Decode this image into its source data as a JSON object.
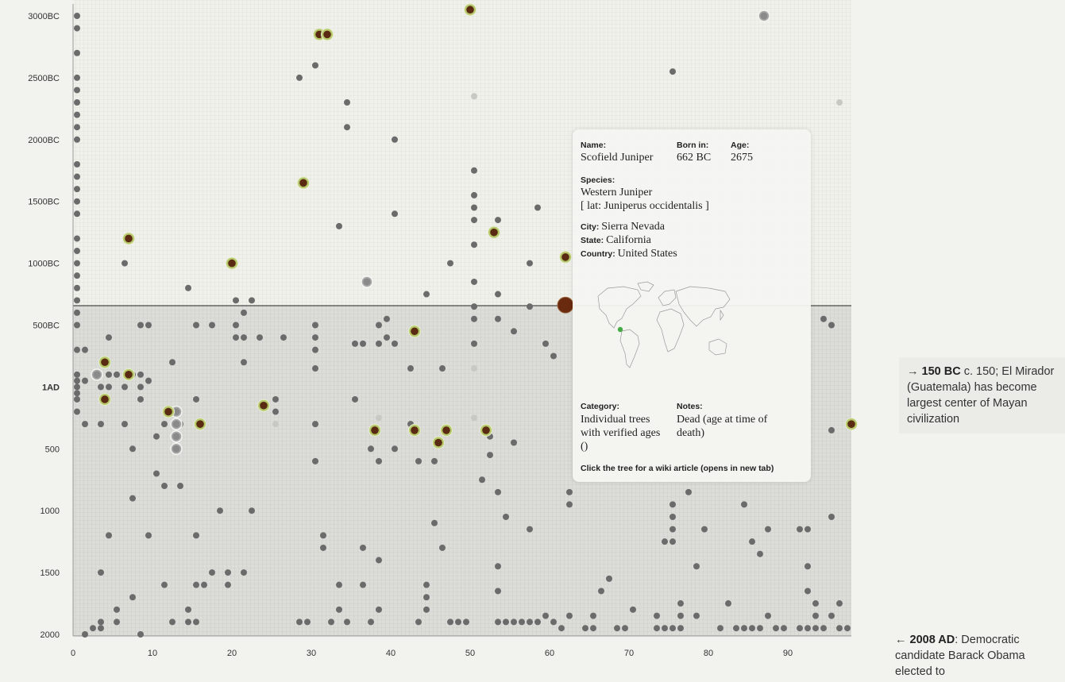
{
  "chart_data": {
    "type": "scatter",
    "title": "",
    "xlabel": "",
    "ylabel": "",
    "xlim": [
      0,
      98
    ],
    "ylim_year": [
      -3050,
      2008
    ],
    "x_ticks": [
      "0",
      "10",
      "20",
      "30",
      "40",
      "50",
      "60",
      "70",
      "80",
      "90"
    ],
    "y_ticks": [
      {
        "label": "3000BC",
        "year": -3000
      },
      {
        "label": "2500BC",
        "year": -2500
      },
      {
        "label": "2000BC",
        "year": -2000
      },
      {
        "label": "1500BC",
        "year": -1500
      },
      {
        "label": "1000BC",
        "year": -1000
      },
      {
        "label": "500BC",
        "year": -500
      },
      {
        "label": "1AD",
        "year": 1
      },
      {
        "label": "500",
        "year": 500
      },
      {
        "label": "1000",
        "year": 1000
      },
      {
        "label": "1500",
        "year": 1500
      },
      {
        "label": "2000",
        "year": 2000
      }
    ],
    "current_year": -150,
    "grid": true,
    "highlighted": {
      "x": 62,
      "year": -662
    },
    "series": [
      {
        "name": "",
        "color": "#6b6b6b",
        "points": [
          [
            0.5,
            -3000
          ],
          [
            0.5,
            -2900
          ],
          [
            0.5,
            -2700
          ],
          [
            0.5,
            -2500
          ],
          [
            0.5,
            -2400
          ],
          [
            0.5,
            -2300
          ],
          [
            0.5,
            -2200
          ],
          [
            0.5,
            -2100
          ],
          [
            0.5,
            -2000
          ],
          [
            0.5,
            -1800
          ],
          [
            0.5,
            -1700
          ],
          [
            0.5,
            -1600
          ],
          [
            0.5,
            -1500
          ],
          [
            0.5,
            -1400
          ],
          [
            0.5,
            -1200
          ],
          [
            0.5,
            -1100
          ],
          [
            0.5,
            -1000
          ],
          [
            0.5,
            -900
          ],
          [
            0.5,
            -800
          ],
          [
            0.5,
            -700
          ],
          [
            0.5,
            -600
          ],
          [
            0.5,
            -500
          ],
          [
            0.5,
            -300
          ],
          [
            0.5,
            -100
          ],
          [
            0.5,
            -50
          ],
          [
            0.5,
            0
          ],
          [
            0.5,
            50
          ],
          [
            0.5,
            100
          ],
          [
            0.5,
            200
          ],
          [
            1.5,
            -300
          ],
          [
            1.5,
            -50
          ],
          [
            1.5,
            300
          ],
          [
            1.5,
            2000
          ],
          [
            2.5,
            1950
          ],
          [
            3.5,
            0
          ],
          [
            3.5,
            300
          ],
          [
            3.5,
            1500
          ],
          [
            3.5,
            1900
          ],
          [
            3.5,
            1950
          ],
          [
            4.5,
            -400
          ],
          [
            4.5,
            0
          ],
          [
            4.5,
            -100
          ],
          [
            4.5,
            1200
          ],
          [
            5.5,
            -100
          ],
          [
            5.5,
            1800
          ],
          [
            5.5,
            1900
          ],
          [
            6.5,
            -1000
          ],
          [
            6.5,
            300
          ],
          [
            6.5,
            0
          ],
          [
            7.5,
            -100
          ],
          [
            7.5,
            500
          ],
          [
            7.5,
            900
          ],
          [
            7.5,
            1700
          ],
          [
            8.5,
            -500
          ],
          [
            8.5,
            0
          ],
          [
            8.5,
            -100
          ],
          [
            8.5,
            100
          ],
          [
            8.5,
            2000
          ],
          [
            9.5,
            -500
          ],
          [
            9.5,
            -50
          ],
          [
            9.5,
            1200
          ],
          [
            10.5,
            400
          ],
          [
            10.5,
            700
          ],
          [
            11.5,
            300
          ],
          [
            11.5,
            800
          ],
          [
            11.5,
            1600
          ],
          [
            12.5,
            -200
          ],
          [
            12.5,
            1900
          ],
          [
            13.5,
            300
          ],
          [
            13.5,
            800
          ],
          [
            14.5,
            -800
          ],
          [
            14.5,
            1800
          ],
          [
            14.5,
            1900
          ],
          [
            15.5,
            -500
          ],
          [
            15.5,
            100
          ],
          [
            15.5,
            1200
          ],
          [
            15.5,
            1600
          ],
          [
            15.5,
            1900
          ],
          [
            16.5,
            1600
          ],
          [
            17.5,
            -500
          ],
          [
            17.5,
            1500
          ],
          [
            18.5,
            1000
          ],
          [
            19.5,
            1500
          ],
          [
            19.5,
            1600
          ],
          [
            20.5,
            -700
          ],
          [
            20.5,
            -500
          ],
          [
            20.5,
            -400
          ],
          [
            21.5,
            -600
          ],
          [
            21.5,
            -400
          ],
          [
            21.5,
            -200
          ],
          [
            21.5,
            1500
          ],
          [
            22.5,
            -700
          ],
          [
            22.5,
            1000
          ],
          [
            23.5,
            -400
          ],
          [
            25.5,
            200
          ],
          [
            25.5,
            100
          ],
          [
            26.5,
            -400
          ],
          [
            28.5,
            -2500
          ],
          [
            28.5,
            1900
          ],
          [
            29.5,
            1900
          ],
          [
            30.5,
            -2600
          ],
          [
            30.5,
            -500
          ],
          [
            30.5,
            -400
          ],
          [
            30.5,
            -300
          ],
          [
            30.5,
            -150
          ],
          [
            30.5,
            300
          ],
          [
            30.5,
            600
          ],
          [
            31.5,
            1200
          ],
          [
            31.5,
            1300
          ],
          [
            32.5,
            1900
          ],
          [
            33.5,
            -1300
          ],
          [
            33.5,
            1600
          ],
          [
            33.5,
            1800
          ],
          [
            34.5,
            -2300
          ],
          [
            34.5,
            -2100
          ],
          [
            34.5,
            1900
          ],
          [
            35.5,
            -350
          ],
          [
            35.5,
            100
          ],
          [
            36.5,
            -350
          ],
          [
            36.5,
            1300
          ],
          [
            36.5,
            1600
          ],
          [
            37.5,
            500
          ],
          [
            37.5,
            1900
          ],
          [
            38.5,
            -500
          ],
          [
            38.5,
            -350
          ],
          [
            38.5,
            600
          ],
          [
            38.5,
            1400
          ],
          [
            38.5,
            1800
          ],
          [
            39.5,
            -550
          ],
          [
            39.5,
            -400
          ],
          [
            40.5,
            -2000
          ],
          [
            40.5,
            -1400
          ],
          [
            40.5,
            -350
          ],
          [
            40.5,
            500
          ],
          [
            42.5,
            -150
          ],
          [
            42.5,
            300
          ],
          [
            43.5,
            600
          ],
          [
            43.5,
            1900
          ],
          [
            44.5,
            -750
          ],
          [
            44.5,
            1600
          ],
          [
            44.5,
            1700
          ],
          [
            44.5,
            1800
          ],
          [
            45.5,
            600
          ],
          [
            45.5,
            1100
          ],
          [
            46.5,
            -150
          ],
          [
            46.5,
            1300
          ],
          [
            47.5,
            -1000
          ],
          [
            47.5,
            1900
          ],
          [
            48.5,
            1900
          ],
          [
            49.5,
            1900
          ],
          [
            50.5,
            -1750
          ],
          [
            50.5,
            -1550
          ],
          [
            50.5,
            -1450
          ],
          [
            50.5,
            -1350
          ],
          [
            50.5,
            -1150
          ],
          [
            50.5,
            -850
          ],
          [
            50.5,
            -650
          ],
          [
            50.5,
            -550
          ],
          [
            50.5,
            -350
          ],
          [
            51.5,
            750
          ],
          [
            52.5,
            400
          ],
          [
            52.5,
            550
          ],
          [
            53.5,
            -1350
          ],
          [
            53.5,
            -750
          ],
          [
            53.5,
            -550
          ],
          [
            53.5,
            850
          ],
          [
            53.5,
            1450
          ],
          [
            53.5,
            1650
          ],
          [
            53.5,
            1900
          ],
          [
            54.5,
            1050
          ],
          [
            54.5,
            1900
          ],
          [
            55.5,
            -450
          ],
          [
            55.5,
            450
          ],
          [
            55.5,
            1900
          ],
          [
            56.5,
            1900
          ],
          [
            57.5,
            -1000
          ],
          [
            57.5,
            -650
          ],
          [
            57.5,
            1150
          ],
          [
            57.5,
            1900
          ],
          [
            58.5,
            -1450
          ],
          [
            58.5,
            1900
          ],
          [
            59.5,
            -350
          ],
          [
            59.5,
            1850
          ],
          [
            60.5,
            -250
          ],
          [
            60.5,
            1900
          ],
          [
            61.5,
            1950
          ],
          [
            62.5,
            850
          ],
          [
            62.5,
            950
          ],
          [
            62.5,
            1850
          ],
          [
            64.5,
            1950
          ],
          [
            65.5,
            1850
          ],
          [
            65.5,
            1950
          ],
          [
            66.5,
            1650
          ],
          [
            67.5,
            1550
          ],
          [
            68.5,
            1950
          ],
          [
            69.5,
            1950
          ],
          [
            70.5,
            1800
          ],
          [
            73.5,
            1850
          ],
          [
            73.5,
            1950
          ],
          [
            74.5,
            1250
          ],
          [
            74.5,
            1950
          ],
          [
            75.5,
            -2550
          ],
          [
            75.5,
            950
          ],
          [
            75.5,
            1050
          ],
          [
            75.5,
            1150
          ],
          [
            75.5,
            1250
          ],
          [
            75.5,
            1950
          ],
          [
            76.5,
            1750
          ],
          [
            76.5,
            1850
          ],
          [
            76.5,
            1950
          ],
          [
            77.5,
            850
          ],
          [
            78.5,
            1450
          ],
          [
            78.5,
            1850
          ],
          [
            79.5,
            1150
          ],
          [
            81.5,
            1950
          ],
          [
            82.5,
            1750
          ],
          [
            83.5,
            1950
          ],
          [
            84.5,
            950
          ],
          [
            84.5,
            1950
          ],
          [
            85.5,
            1250
          ],
          [
            85.5,
            1950
          ],
          [
            86.5,
            1350
          ],
          [
            86.5,
            1950
          ],
          [
            87.5,
            1150
          ],
          [
            87.5,
            1850
          ],
          [
            88.5,
            1950
          ],
          [
            89.5,
            1950
          ],
          [
            91.5,
            1150
          ],
          [
            91.5,
            1950
          ],
          [
            92.5,
            1150
          ],
          [
            92.5,
            1450
          ],
          [
            92.5,
            1650
          ],
          [
            92.5,
            1950
          ],
          [
            93.5,
            1750
          ],
          [
            93.5,
            1850
          ],
          [
            93.5,
            1950
          ],
          [
            94.5,
            -550
          ],
          [
            94.5,
            1950
          ],
          [
            95.5,
            -500
          ],
          [
            95.5,
            350
          ],
          [
            95.5,
            1050
          ],
          [
            95.5,
            1850
          ],
          [
            96.5,
            1750
          ],
          [
            96.5,
            1950
          ],
          [
            97.5,
            1950
          ]
        ]
      },
      {
        "name": "",
        "color": "#c8c8c4",
        "points": [
          [
            50.5,
            -2350
          ],
          [
            50.5,
            -150
          ],
          [
            50.5,
            250
          ],
          [
            25.5,
            300
          ],
          [
            38.5,
            250
          ],
          [
            96.5,
            -2300
          ]
        ]
      },
      {
        "name": "",
        "color": "#5a2a12",
        "points": [
          [
            7,
            -1200
          ],
          [
            4,
            -200
          ],
          [
            7,
            -100
          ],
          [
            4,
            100
          ],
          [
            12,
            200
          ],
          [
            16,
            300
          ],
          [
            20,
            -1000
          ],
          [
            24,
            150
          ],
          [
            29,
            -1650
          ],
          [
            31,
            -2850
          ],
          [
            32,
            -2850
          ],
          [
            38,
            350
          ],
          [
            43,
            -450
          ],
          [
            43,
            350
          ],
          [
            46,
            450
          ],
          [
            47,
            350
          ],
          [
            50,
            -3050
          ],
          [
            52,
            350
          ],
          [
            53,
            -1250
          ],
          [
            62,
            -1050
          ],
          [
            98,
            300
          ]
        ]
      },
      {
        "name": "",
        "color": "#8a8a8a",
        "points": [
          [
            37,
            -850
          ],
          [
            87,
            -3000
          ],
          [
            3,
            -100
          ],
          [
            13,
            200
          ],
          [
            13,
            300
          ],
          [
            13,
            400
          ],
          [
            13,
            500
          ]
        ]
      }
    ]
  },
  "tooltip": {
    "name_label": "Name:",
    "name": "Scofield Juniper",
    "born_label": "Born in:",
    "born": "662 BC",
    "age_label": "Age:",
    "age": "2675",
    "species_label": "Species:",
    "species": "Western Juniper",
    "latin": "[ lat: Juniperus occidentalis ]",
    "city_label": "City:",
    "city": "Sierra Nevada",
    "state_label": "State:",
    "state": "California",
    "country_label": "Country:",
    "country": "United States",
    "category_label": "Category:",
    "category": "Individual trees with verified ages ()",
    "notes_label": "Notes:",
    "notes": "Dead (age at time of death)",
    "footer": "Click the tree for a wiki article (opens in new tab)",
    "map_marker_color": "#44aa44"
  },
  "events": [
    {
      "arrow": "→",
      "year": "150 BC",
      "text": " c. 150; El Mirador (Guatemala) has become largest center of Mayan civilization"
    },
    {
      "arrow": "←",
      "year": "2008 AD",
      "text": ": Democratic candidate Barack Obama elected to"
    }
  ]
}
